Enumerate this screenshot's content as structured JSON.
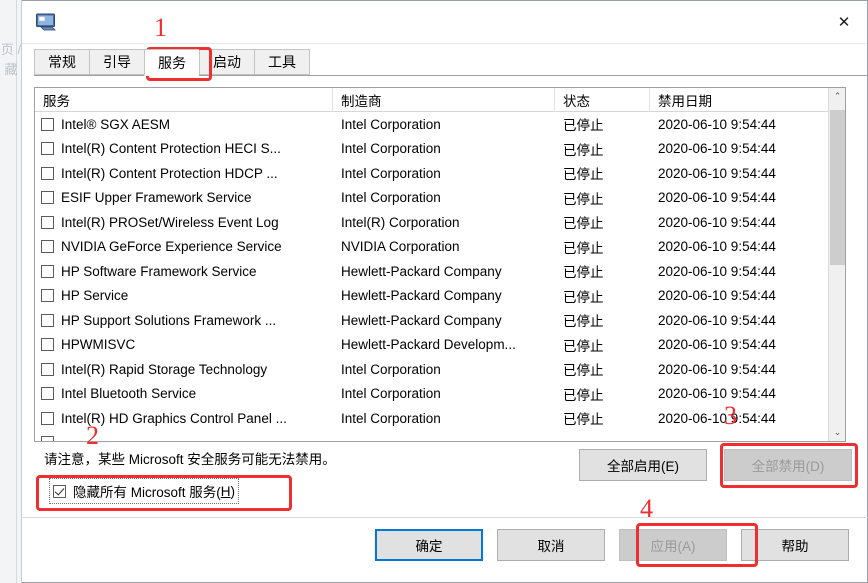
{
  "window": {
    "title": "",
    "icon": "system-configuration-icon",
    "close_label": "✕"
  },
  "tabs": [
    {
      "label": "常规",
      "active": false
    },
    {
      "label": "引导",
      "active": false
    },
    {
      "label": "服务",
      "active": true
    },
    {
      "label": "启动",
      "active": false
    },
    {
      "label": "工具",
      "active": false
    }
  ],
  "table": {
    "headers": {
      "service": "服务",
      "manufacturer": "制造商",
      "status": "状态",
      "disabled_date": "禁用日期"
    },
    "rows": [
      {
        "checked": false,
        "service": "Intel® SGX AESM",
        "manufacturer": "Intel Corporation",
        "status": "已停止",
        "date": "2020-06-10 9:54:44"
      },
      {
        "checked": false,
        "service": "Intel(R) Content Protection HECI S...",
        "manufacturer": "Intel Corporation",
        "status": "已停止",
        "date": "2020-06-10 9:54:44"
      },
      {
        "checked": false,
        "service": "Intel(R) Content Protection HDCP ...",
        "manufacturer": "Intel Corporation",
        "status": "已停止",
        "date": "2020-06-10 9:54:44"
      },
      {
        "checked": false,
        "service": "ESIF Upper Framework Service",
        "manufacturer": "Intel Corporation",
        "status": "已停止",
        "date": "2020-06-10 9:54:44"
      },
      {
        "checked": false,
        "service": "Intel(R) PROSet/Wireless Event Log",
        "manufacturer": "Intel(R) Corporation",
        "status": "已停止",
        "date": "2020-06-10 9:54:44"
      },
      {
        "checked": false,
        "service": "NVIDIA GeForce Experience Service",
        "manufacturer": "NVIDIA Corporation",
        "status": "已停止",
        "date": "2020-06-10 9:54:44"
      },
      {
        "checked": false,
        "service": "HP Software Framework Service",
        "manufacturer": "Hewlett-Packard Company",
        "status": "已停止",
        "date": "2020-06-10 9:54:44"
      },
      {
        "checked": false,
        "service": "HP Service",
        "manufacturer": "Hewlett-Packard Company",
        "status": "已停止",
        "date": "2020-06-10 9:54:44"
      },
      {
        "checked": false,
        "service": "HP Support Solutions Framework ...",
        "manufacturer": "Hewlett-Packard Company",
        "status": "已停止",
        "date": "2020-06-10 9:54:44"
      },
      {
        "checked": false,
        "service": "HPWMISVC",
        "manufacturer": "Hewlett-Packard Developm...",
        "status": "已停止",
        "date": "2020-06-10 9:54:44"
      },
      {
        "checked": false,
        "service": "Intel(R) Rapid Storage Technology",
        "manufacturer": "Intel Corporation",
        "status": "已停止",
        "date": "2020-06-10 9:54:44"
      },
      {
        "checked": false,
        "service": "Intel Bluetooth Service",
        "manufacturer": "Intel Corporation",
        "status": "已停止",
        "date": "2020-06-10 9:54:44"
      },
      {
        "checked": false,
        "service": "Intel(R) HD Graphics Control Panel ...",
        "manufacturer": "Intel Corporation",
        "status": "已停止",
        "date": "2020-06-10 9:54:44"
      },
      {
        "checked": false,
        "service": "",
        "manufacturer": "",
        "status": "",
        "date": ""
      }
    ]
  },
  "note": "请注意，某些 Microsoft 安全服务可能无法禁用。",
  "hide_microsoft": {
    "label_prefix": "隐藏所有 Microsoft 服务(",
    "accel": "H",
    "label_suffix": ")",
    "checked": true
  },
  "buttons": {
    "enable_all": "全部启用(E)",
    "disable_all": "全部禁用(D)",
    "ok": "确定",
    "cancel": "取消",
    "apply": "应用(A)",
    "help": "帮助"
  },
  "annotations": {
    "n1": "1",
    "n2": "2",
    "n3": "3",
    "n4": "4",
    "color": "#ef2f2f"
  },
  "scrollbar": {
    "up_arrow": "⌃",
    "down_arrow": "⌄"
  },
  "background": {
    "strip": "页 / 藏"
  }
}
